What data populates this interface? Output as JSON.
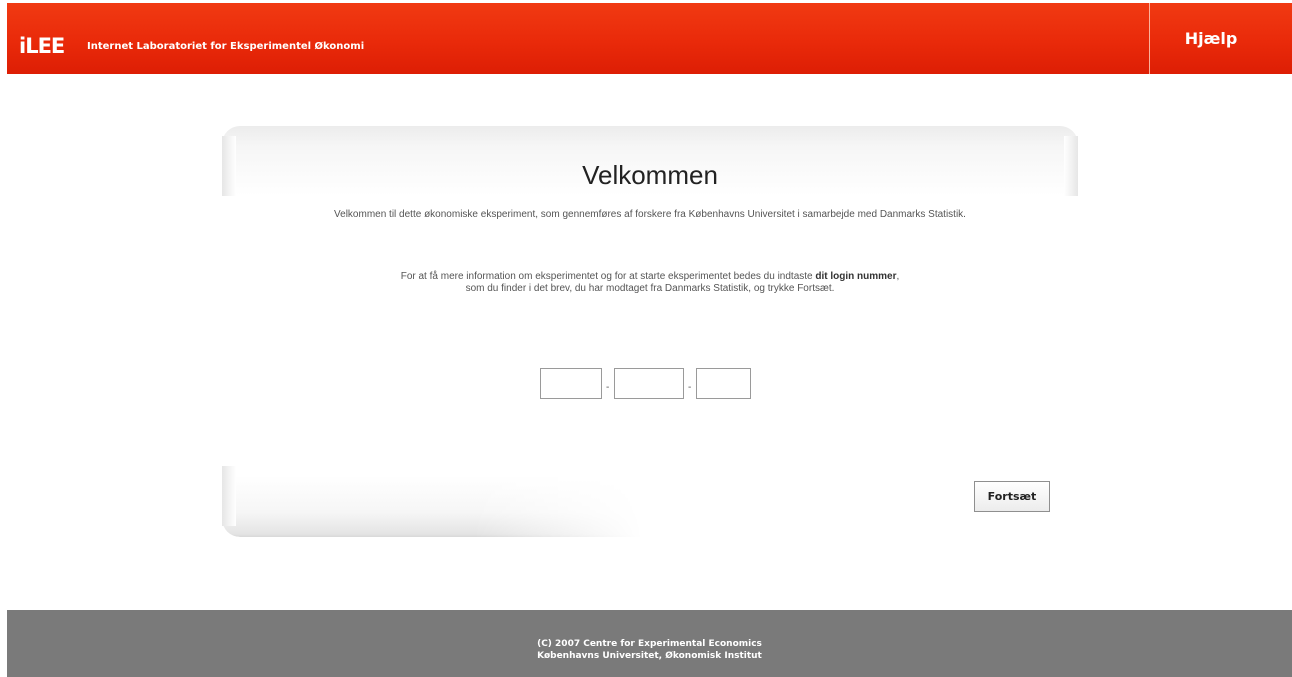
{
  "header": {
    "logo": "iLEE",
    "tagline": "Internet Laboratoriet for Eksperimentel Økonomi",
    "help_label": "Hjælp"
  },
  "main": {
    "title": "Velkommen",
    "intro": "Velkommen til dette økonomiske eksperiment, som gennemføres af forskere fra Københavns Universitet i samarbejde med Danmarks Statistik.",
    "instructions_before": "For at få mere information om eksperimentet og for at starte eksperimentet bedes du indtaste ",
    "instructions_bold": "dit login nummer",
    "instructions_after": ",",
    "instructions_line2": "som du finder i det brev, du har modtaget fra Danmarks Statistik, og trykke Fortsæt.",
    "login": {
      "separator_1": "-",
      "separator_2": "-",
      "field_1_value": "",
      "field_2_value": "",
      "field_3_value": ""
    },
    "continue_label": "Fortsæt"
  },
  "footer": {
    "line1": "(C) 2007 Centre for Experimental Economics",
    "line2": "Københavns Universitet, Økonomisk Institut"
  },
  "colors": {
    "header_red": "#e92a0a",
    "footer_gray": "#7a7a7a"
  }
}
